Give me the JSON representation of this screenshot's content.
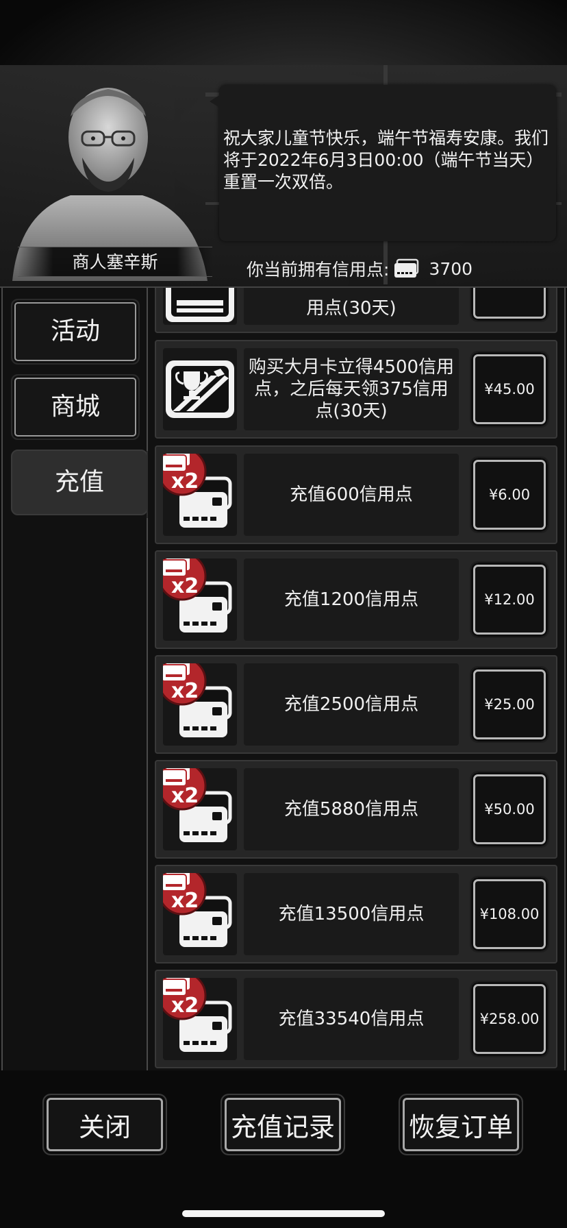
{
  "header": {
    "merchant_name": "商人塞辛斯",
    "announcement": "祝大家儿童节快乐，端午节福寿安康。我们将于2022年6月3日00:00（端午节当天）重置一次双倍。",
    "credits_label": "你当前拥有信用点:",
    "credits_value": "3700",
    "credits_icon": "credit-card-icon"
  },
  "sidebar": {
    "tabs": [
      {
        "label": "活动",
        "active": false
      },
      {
        "label": "商城",
        "active": false
      },
      {
        "label": "充值",
        "active": true
      }
    ]
  },
  "list": {
    "items": [
      {
        "icon": "card-icon",
        "description": "用点(30天)",
        "price": ""
      },
      {
        "icon": "trophy-card-icon",
        "description": "购买大月卡立得4500信用点，之后每天领375信用点(30天)",
        "price": "¥45.00"
      },
      {
        "icon": "double-credit-cards-icon",
        "badge": "x2",
        "description": "充值600信用点",
        "price": "¥6.00"
      },
      {
        "icon": "double-credit-cards-icon",
        "badge": "x2",
        "description": "充值1200信用点",
        "price": "¥12.00"
      },
      {
        "icon": "double-credit-cards-icon",
        "badge": "x2",
        "description": "充值2500信用点",
        "price": "¥25.00"
      },
      {
        "icon": "double-credit-cards-icon",
        "badge": "x2",
        "description": "充值5880信用点",
        "price": "¥50.00"
      },
      {
        "icon": "double-credit-cards-icon",
        "badge": "x2",
        "description": "充值13500信用点",
        "price": "¥108.00"
      },
      {
        "icon": "double-credit-cards-icon",
        "badge": "x2",
        "description": "充值33540信用点",
        "price": "¥258.00"
      }
    ]
  },
  "footer": {
    "close_label": "关闭",
    "history_label": "充值记录",
    "restore_label": "恢复订单"
  },
  "colors": {
    "badge_red": "#b3262b",
    "panel_bg": "#262626"
  }
}
